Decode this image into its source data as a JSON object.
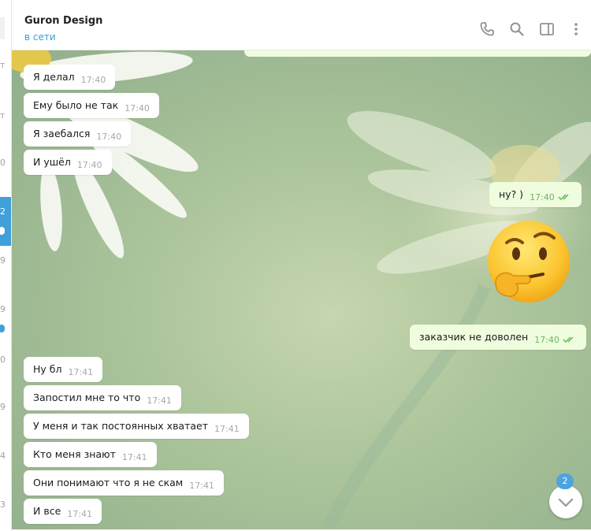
{
  "sidebar": {
    "fragments": [
      "т",
      "т",
      "0",
      "2",
      "9",
      "9",
      "0",
      "9",
      "4",
      "3"
    ]
  },
  "header": {
    "contact_name": "Guron Design",
    "status": "в сети",
    "icons": [
      "phone-icon",
      "search-icon",
      "sidebar-toggle-icon",
      "more-vertical-icon"
    ]
  },
  "messages_top": [
    {
      "text": "Я делал",
      "time": "17:40"
    },
    {
      "text": "Ему было не так",
      "time": "17:40"
    },
    {
      "text": "Я заебался",
      "time": "17:40"
    },
    {
      "text": "И ушёл",
      "time": "17:40"
    }
  ],
  "outgoing": [
    {
      "text": "ну? )",
      "time": "17:40"
    },
    {
      "text": "заказчик не доволен",
      "time": "17:40"
    }
  ],
  "sticker": "thinking-face-emoji",
  "messages_bottom": [
    {
      "text": "Ну бл",
      "time": "17:41"
    },
    {
      "text": "Запостил мне то что",
      "time": "17:41"
    },
    {
      "text": "У меня и так постоянных хватает",
      "time": "17:41"
    },
    {
      "text": "Кто меня знают",
      "time": "17:41"
    },
    {
      "text": "Они понимают что я не скам",
      "time": "17:41"
    },
    {
      "text": "И все",
      "time": "17:41"
    }
  ],
  "scroll_down": {
    "unread_count": "2"
  },
  "colors": {
    "accent": "#419fd9",
    "outgoing_bubble": "#effdde",
    "incoming_bubble": "#ffffff",
    "read_check": "#5fb85a"
  }
}
